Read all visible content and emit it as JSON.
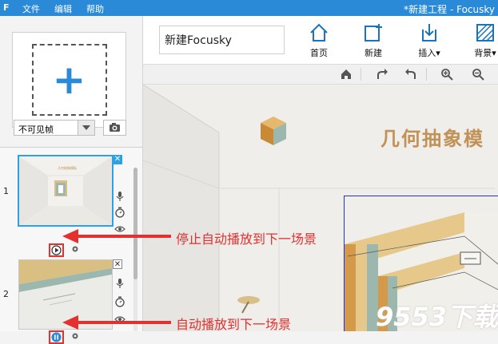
{
  "titlebar": {
    "logo": "F",
    "menus": [
      "文件",
      "编辑",
      "帮助"
    ],
    "window_title": "*新建工程 - Focusky"
  },
  "left_panel": {
    "add_frame_icon": "plus-icon",
    "frame_visibility_value": "不可见帧",
    "camera_icon": "camera-icon",
    "slides": [
      {
        "number": "1",
        "selected": true,
        "autoplay_icon": "play-icon"
      },
      {
        "number": "2",
        "selected": false,
        "autoplay_icon": "pause-icon"
      }
    ],
    "thumb1_title": "几何抽象模板"
  },
  "toolbar": {
    "title_value": "新建Focusky",
    "buttons": [
      {
        "label": "首页",
        "icon": "home-icon"
      },
      {
        "label": "新建",
        "icon": "new-icon"
      },
      {
        "label": "插入",
        "icon": "insert-icon",
        "dropdown": true
      },
      {
        "label": "背景",
        "icon": "background-icon",
        "dropdown": true
      }
    ]
  },
  "subbar_icons": [
    "home-small-icon",
    "redo-icon",
    "undo-icon",
    "zoom-in-icon",
    "zoom-out-icon"
  ],
  "canvas": {
    "title": "几何抽象模"
  },
  "annotations": {
    "stop_autoplay": "停止自动播放到下一场景",
    "autoplay": "自动播放到下一场景"
  },
  "watermark": "9553下载",
  "colors": {
    "accent": "#2a8ad8",
    "annotation_red": "#e0312f",
    "title_gold": "#c29155"
  }
}
